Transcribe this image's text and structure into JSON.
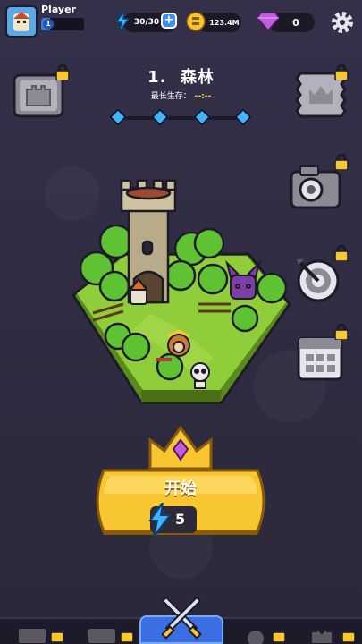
{
  "player": {
    "name": "Player",
    "level": "1",
    "level_progress": 0.2
  },
  "resources": {
    "energy": "30/30",
    "coins": "123.4M",
    "gems": "0"
  },
  "stage": {
    "number": "1.",
    "name": "森林",
    "survive_label": "最长生存：",
    "survive_value": "--:--",
    "progress_nodes": 4
  },
  "start": {
    "label": "开始",
    "cost": "5"
  },
  "icons": {
    "settings": "gear-icon",
    "energy": "lightning-icon",
    "coin": "coin-icon",
    "gem": "gem-icon",
    "lock": "lock-icon",
    "castle": "castle-icon",
    "crown_stamp": "crown-stamp-icon",
    "camera": "camera-icon",
    "target": "target-icon",
    "calendar": "calendar-icon",
    "swords": "crossed-swords-icon"
  },
  "colors": {
    "background": "#2e2a3e",
    "accent_blue": "#3fb4ff",
    "gold": "#f7c631",
    "energy": "#3fb4ff",
    "gem": "#c45ce0"
  }
}
